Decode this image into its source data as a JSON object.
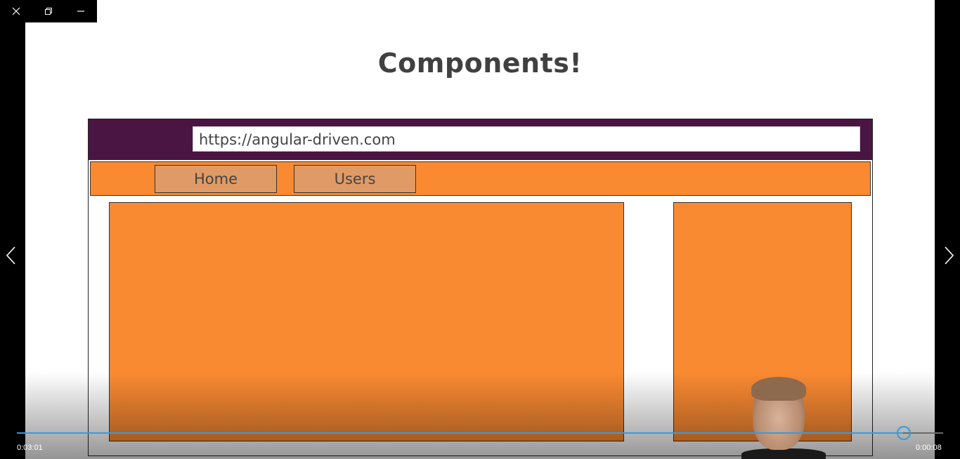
{
  "window": {
    "controls": {
      "close_icon": "close-icon",
      "restore_icon": "restore-icon",
      "minimize_icon": "minimize-icon"
    }
  },
  "slide": {
    "title": "Components!",
    "mockup": {
      "url": "https://angular-driven.com",
      "nav_items": [
        "Home",
        "Users"
      ],
      "colors": {
        "header": "#4a1443",
        "accent": "#fa8a32",
        "button": "#e09a66"
      }
    }
  },
  "player": {
    "current_time": "0:03:01",
    "remaining_time": "0:00:08",
    "progress": 0.957,
    "prev_icon": "chevron-left-icon",
    "next_icon": "chevron-right-icon",
    "accent_color": "#3a9ad9"
  }
}
